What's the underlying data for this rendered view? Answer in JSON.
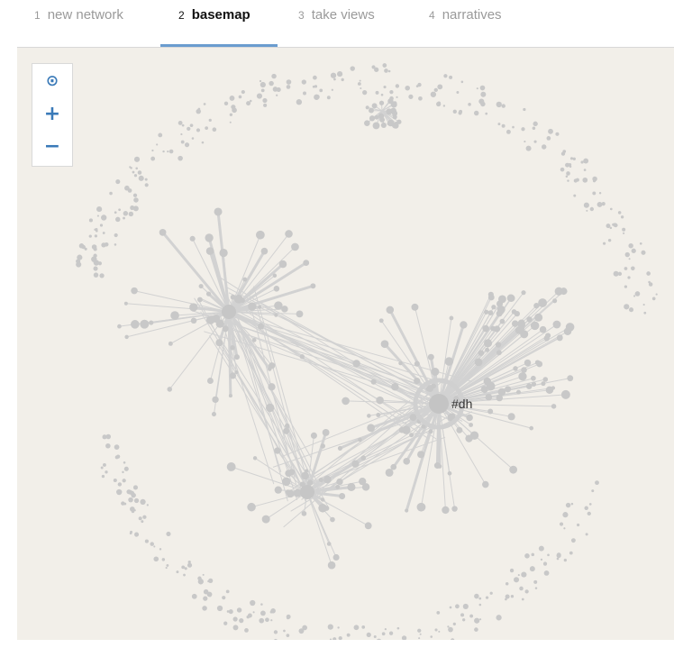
{
  "tabs": [
    {
      "num": "1",
      "label": "new network",
      "active": false
    },
    {
      "num": "2",
      "label": "basemap",
      "active": true
    },
    {
      "num": "3",
      "label": "take views",
      "active": false
    },
    {
      "num": "4",
      "label": "narratives",
      "active": false
    }
  ],
  "zoom_controls": {
    "locate_glyph": "⊙",
    "zoom_in_glyph": "+",
    "zoom_out_glyph": "−",
    "icon_color": "#3a7ab8"
  },
  "network": {
    "node_label": "#dh",
    "background_color": "#f2efe9",
    "node_color": "#c8c8c8",
    "edge_color": "#d2d2d2"
  },
  "icons": {
    "locate": "locate-icon",
    "zoom_in": "zoom-in-icon",
    "zoom_out": "zoom-out-icon"
  }
}
